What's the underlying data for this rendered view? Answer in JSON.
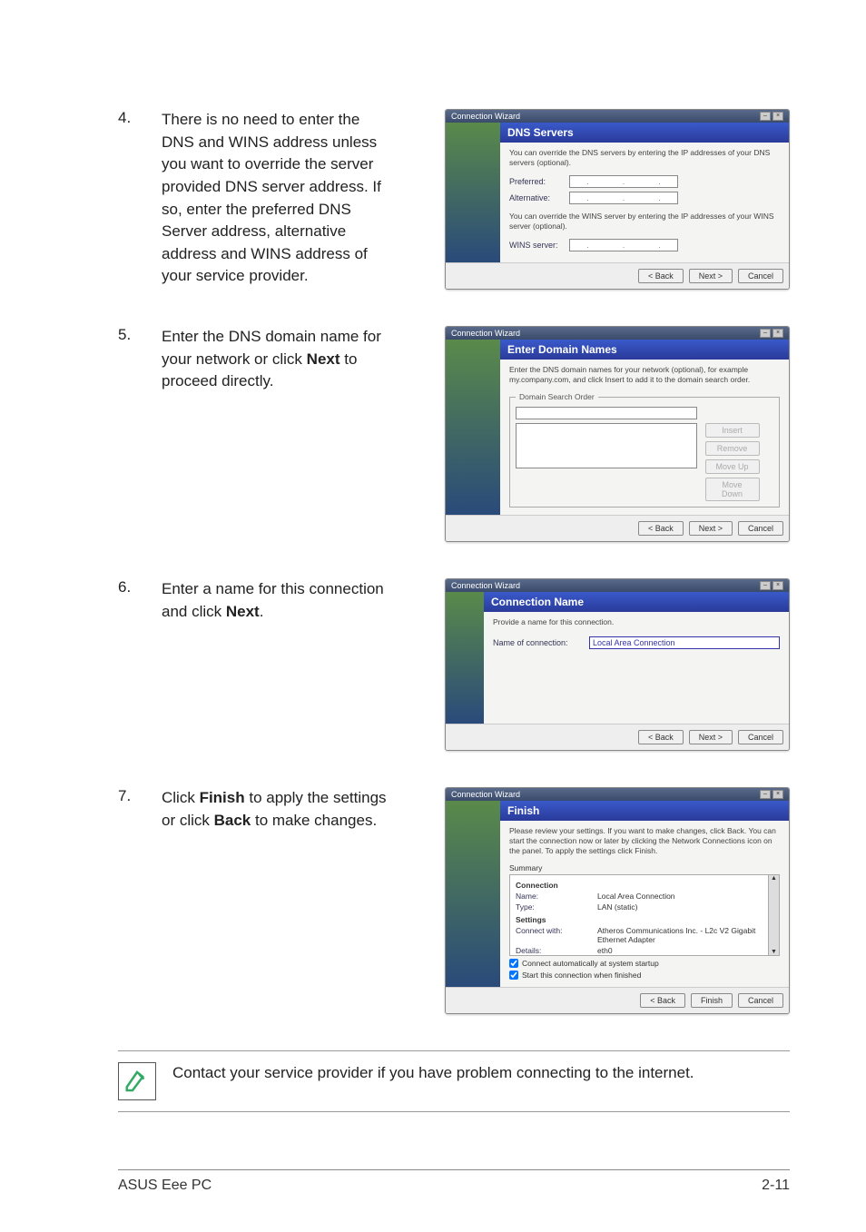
{
  "steps": {
    "s4": {
      "num": "4.",
      "text_a": "There is no need to enter the DNS and WINS address unless you want to override the server provided DNS server address. If so, enter the preferred DNS Server address, alternative address and WINS address of your service provider."
    },
    "s5": {
      "num": "5.",
      "text_a": "Enter the DNS domain name for your network or click ",
      "bold": "Next",
      "text_b": " to proceed directly."
    },
    "s6": {
      "num": "6.",
      "text_a": "Enter a name for this connection and click ",
      "bold": "Next",
      "text_b": "."
    },
    "s7": {
      "num": "7.",
      "text_a": "Click ",
      "bold1": "Finish",
      "text_b": " to apply the settings or click ",
      "bold2": "Back",
      "text_c": " to make changes."
    }
  },
  "dlg": {
    "window_title": "Connection Wizard",
    "buttons": {
      "back": "< Back",
      "next": "Next >",
      "finish": "Finish",
      "cancel": "Cancel"
    },
    "dns": {
      "header": "DNS Servers",
      "desc": "You can override the DNS servers by entering the IP addresses of your DNS servers (optional).",
      "preferred": "Preferred:",
      "alternative": "Alternative:",
      "desc2": "You can override the WINS server by entering the IP addresses of your WINS server (optional).",
      "wins": "WINS server:"
    },
    "domain": {
      "header": "Enter Domain Names",
      "desc": "Enter the DNS domain names for your network (optional), for example my.company.com, and click Insert to add it to the domain search order.",
      "fieldset": "Domain Search Order",
      "btn_insert": "Insert",
      "btn_remove": "Remove",
      "btn_up": "Move Up",
      "btn_down": "Move Down"
    },
    "connname": {
      "header": "Connection Name",
      "desc": "Provide a name for this connection.",
      "label": "Name of connection:",
      "value": "Local Area Connection"
    },
    "finish": {
      "header": "Finish",
      "desc": "Please review your settings. If you want to make changes, click Back. You can start the connection now or later by clicking the Network Connections icon on the panel. To apply the settings click Finish.",
      "summary_label": "Summary",
      "conn_heading": "Connection",
      "name_k": "Name:",
      "name_v": "Local Area Connection",
      "type_k": "Type:",
      "type_v": "LAN (static)",
      "settings_heading": "Settings",
      "connectwith_k": "Connect with:",
      "connectwith_v": "Atheros Communications Inc. - L2c V2 Gigabit Ethernet Adapter",
      "details_k": "Details:",
      "details_v": "eth0",
      "chk1": "Connect automatically at system startup",
      "chk2": "Start this connection when finished"
    }
  },
  "note": "Contact your service provider if you have problem connecting to the internet.",
  "footer": {
    "left": "ASUS Eee PC",
    "right": "2-11"
  }
}
